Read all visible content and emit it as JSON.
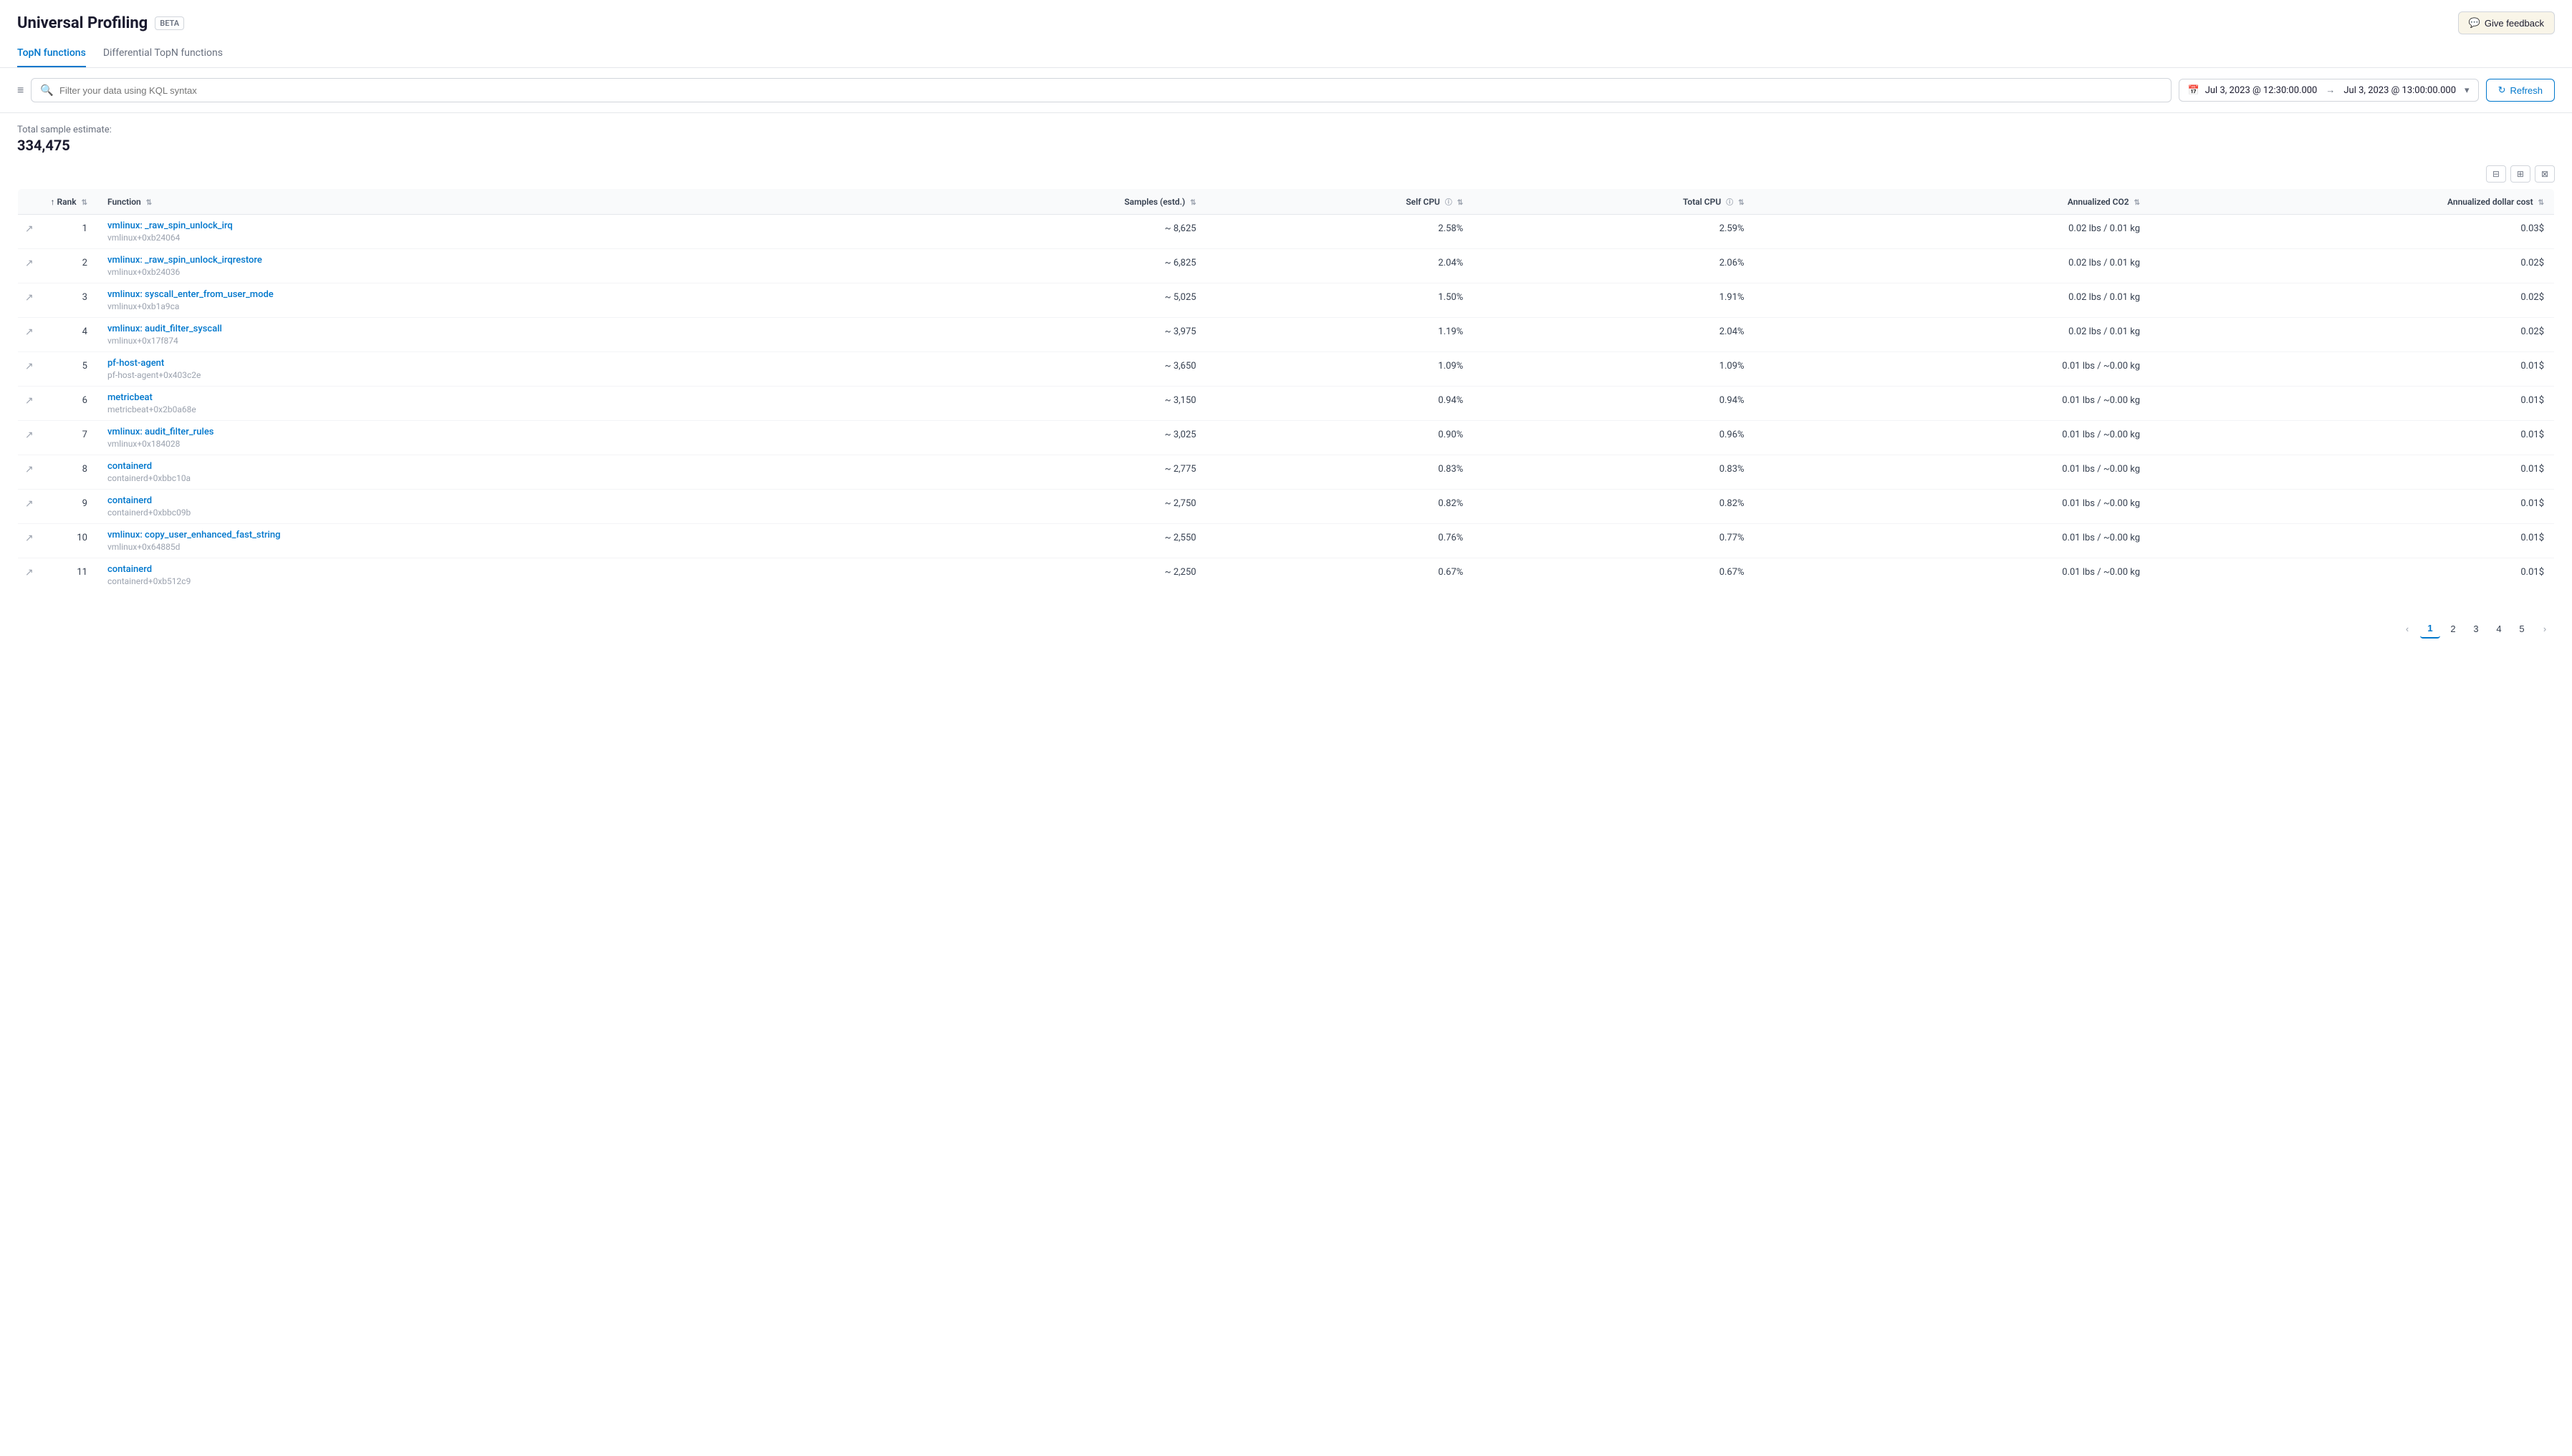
{
  "header": {
    "title": "Universal Profiling",
    "beta_label": "BETA",
    "feedback_btn": "Give feedback"
  },
  "tabs": [
    {
      "id": "topn",
      "label": "TopN functions",
      "active": true
    },
    {
      "id": "diff",
      "label": "Differential TopN functions",
      "active": false
    }
  ],
  "toolbar": {
    "filter_placeholder": "Filter your data using KQL syntax",
    "date_start": "Jul 3, 2023 @ 12:30:00.000",
    "date_end": "Jul 3, 2023 @ 13:00:00.000",
    "refresh_label": "Refresh"
  },
  "summary": {
    "label": "Total sample estimate:",
    "value": "334,475"
  },
  "table": {
    "columns": [
      {
        "id": "rank",
        "label": "Rank",
        "sortable": true
      },
      {
        "id": "function",
        "label": "Function",
        "sortable": true
      },
      {
        "id": "samples",
        "label": "Samples (estd.)",
        "sortable": true
      },
      {
        "id": "self_cpu",
        "label": "Self CPU",
        "info": true,
        "sortable": true
      },
      {
        "id": "total_cpu",
        "label": "Total CPU",
        "info": true,
        "sortable": true
      },
      {
        "id": "annualized_co2",
        "label": "Annualized CO2",
        "sortable": true
      },
      {
        "id": "annualized_cost",
        "label": "Annualized dollar cost",
        "sortable": true
      }
    ],
    "rows": [
      {
        "rank": 1,
        "fn_name": "vmlinux: _raw_spin_unlock_irq",
        "fn_addr": "vmlinux+0xb24064",
        "samples": "~ 8,625",
        "self_cpu": "2.58%",
        "total_cpu": "2.59%",
        "co2": "0.02 lbs / 0.01 kg",
        "cost": "0.03$"
      },
      {
        "rank": 2,
        "fn_name": "vmlinux: _raw_spin_unlock_irqrestore",
        "fn_addr": "vmlinux+0xb24036",
        "samples": "~ 6,825",
        "self_cpu": "2.04%",
        "total_cpu": "2.06%",
        "co2": "0.02 lbs / 0.01 kg",
        "cost": "0.02$"
      },
      {
        "rank": 3,
        "fn_name": "vmlinux: syscall_enter_from_user_mode",
        "fn_addr": "vmlinux+0xb1a9ca",
        "samples": "~ 5,025",
        "self_cpu": "1.50%",
        "total_cpu": "1.91%",
        "co2": "0.02 lbs / 0.01 kg",
        "cost": "0.02$"
      },
      {
        "rank": 4,
        "fn_name": "vmlinux: audit_filter_syscall",
        "fn_addr": "vmlinux+0x17f874",
        "samples": "~ 3,975",
        "self_cpu": "1.19%",
        "total_cpu": "2.04%",
        "co2": "0.02 lbs / 0.01 kg",
        "cost": "0.02$"
      },
      {
        "rank": 5,
        "fn_name": "pf-host-agent",
        "fn_addr": "pf-host-agent+0x403c2e",
        "samples": "~ 3,650",
        "self_cpu": "1.09%",
        "total_cpu": "1.09%",
        "co2": "0.01 lbs / ~0.00 kg",
        "cost": "0.01$"
      },
      {
        "rank": 6,
        "fn_name": "metricbeat",
        "fn_addr": "metricbeat+0x2b0a68e",
        "samples": "~ 3,150",
        "self_cpu": "0.94%",
        "total_cpu": "0.94%",
        "co2": "0.01 lbs / ~0.00 kg",
        "cost": "0.01$"
      },
      {
        "rank": 7,
        "fn_name": "vmlinux: audit_filter_rules",
        "fn_addr": "vmlinux+0x184028",
        "samples": "~ 3,025",
        "self_cpu": "0.90%",
        "total_cpu": "0.96%",
        "co2": "0.01 lbs / ~0.00 kg",
        "cost": "0.01$"
      },
      {
        "rank": 8,
        "fn_name": "containerd",
        "fn_addr": "containerd+0xbbc10a",
        "samples": "~ 2,775",
        "self_cpu": "0.83%",
        "total_cpu": "0.83%",
        "co2": "0.01 lbs / ~0.00 kg",
        "cost": "0.01$"
      },
      {
        "rank": 9,
        "fn_name": "containerd",
        "fn_addr": "containerd+0xbbc09b",
        "samples": "~ 2,750",
        "self_cpu": "0.82%",
        "total_cpu": "0.82%",
        "co2": "0.01 lbs / ~0.00 kg",
        "cost": "0.01$"
      },
      {
        "rank": 10,
        "fn_name": "vmlinux: copy_user_enhanced_fast_string",
        "fn_addr": "vmlinux+0x64885d",
        "samples": "~ 2,550",
        "self_cpu": "0.76%",
        "total_cpu": "0.77%",
        "co2": "0.01 lbs / ~0.00 kg",
        "cost": "0.01$"
      },
      {
        "rank": 11,
        "fn_name": "containerd",
        "fn_addr": "containerd+0xb512c9",
        "samples": "~ 2,250",
        "self_cpu": "0.67%",
        "total_cpu": "0.67%",
        "co2": "0.01 lbs / ~0.00 kg",
        "cost": "0.01$"
      }
    ]
  },
  "pagination": {
    "pages": [
      1,
      2,
      3,
      4,
      5
    ],
    "current": 1
  }
}
